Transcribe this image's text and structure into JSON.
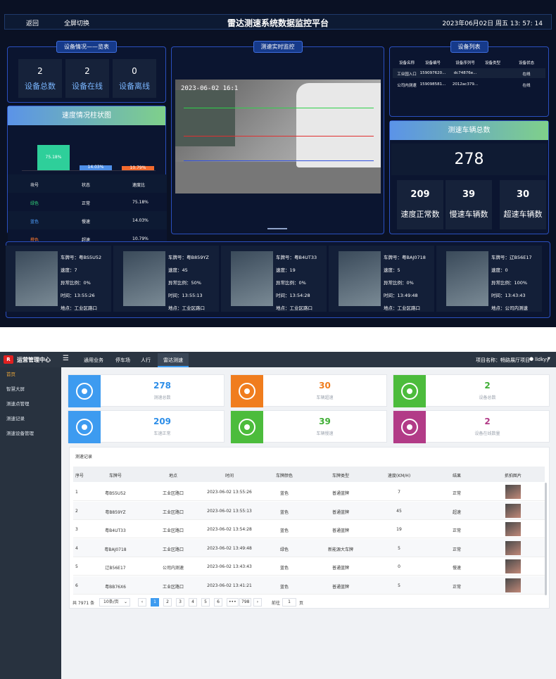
{
  "dashboard": {
    "nav_back": "返回",
    "nav_fullscreen": "全屏切换",
    "title": "雷达测速系统数据监控平台",
    "datetime": "2023年06月02日 周五 13: 57: 14",
    "device_overview": {
      "title": "设备情况——览表",
      "total": {
        "value": "2",
        "label": "设备总数"
      },
      "online": {
        "value": "2",
        "label": "设备在线"
      },
      "offline": {
        "value": "0",
        "label": "设备离线"
      }
    },
    "speed_chart": {
      "title": "速度情况柱状图",
      "bars": [
        {
          "label": "75.18%",
          "value": 75.18,
          "color": "#2ecf9a"
        },
        {
          "label": "14.03%",
          "value": 14.03,
          "color": "#4e8fe8"
        },
        {
          "label": "10.79%",
          "value": 10.79,
          "color": "#f26a2e"
        }
      ],
      "headers": [
        "块号",
        "状态",
        "速度比"
      ],
      "rows": [
        {
          "block": "绿色",
          "status": "正常",
          "ratio": "75.18%",
          "color": "#32d27a"
        },
        {
          "block": "蓝色",
          "status": "慢速",
          "ratio": "14.03%",
          "color": "#4ea0ff"
        },
        {
          "block": "橙色",
          "status": "超速",
          "ratio": "10.79%",
          "color": "#ff7a2e"
        }
      ]
    },
    "live": {
      "title": "测速实时监控",
      "timestamp": "2023-06-02 16:1"
    },
    "device_list": {
      "title": "设备列表",
      "headers": [
        "设备名称",
        "设备编号",
        "设备序列号",
        "设备类型",
        "设备状态"
      ],
      "rows": [
        [
          "工业园入口",
          "159097620...",
          "dc74876e...",
          "",
          "在线"
        ],
        [
          "公司内测速",
          "159098581...",
          "2012ac379...",
          "",
          "在线"
        ]
      ]
    },
    "totals": {
      "title": "测速车辆总数",
      "total": "278",
      "normal": {
        "value": "209",
        "label": "速度正常数"
      },
      "slow": {
        "value": "39",
        "label": "慢速车辆数"
      },
      "fast": {
        "value": "30",
        "label": "超速车辆数"
      }
    },
    "captures": [
      {
        "plate": "车牌号：粤BS5U52",
        "speed": "速度：7",
        "ratio": "异常比例：0%",
        "time": "时间：13:55:26",
        "place": "地点：工业区路口"
      },
      {
        "plate": "车牌号：粤B859YZ",
        "speed": "速度：45",
        "ratio": "异常比例：50%",
        "time": "时间：13:55:13",
        "place": "地点：工业区路口"
      },
      {
        "plate": "车牌号：粤B4UT33",
        "speed": "速度：19",
        "ratio": "异常比例：0%",
        "time": "时间：13:54:28",
        "place": "地点：工业区路口"
      },
      {
        "plate": "车牌号：粤BAJ0718",
        "speed": "速度：5",
        "ratio": "异常比例：0%",
        "time": "时间：13:49:48",
        "place": "地点：工业区路口"
      },
      {
        "plate": "车牌号：辽B56E17",
        "speed": "速度：0",
        "ratio": "异常比例：100%",
        "time": "时间：13:43:43",
        "place": "地点：公司内测速"
      }
    ]
  },
  "admin": {
    "brand": "运营管理中心",
    "tabs": [
      "通用业务",
      "停车场",
      "人行",
      "雷达测速"
    ],
    "project": "项目名称：畅路展厅项目",
    "user": "lldkyy",
    "menu": [
      "首页",
      "智慧大屏",
      "测速点管理",
      "测速记录",
      "测速设备管理"
    ],
    "tiles": [
      {
        "value": "278",
        "label": "测速总数",
        "color": "#3d9bf0",
        "valcolor": "#2d8ee8",
        "icon": "camera-icon"
      },
      {
        "value": "30",
        "label": "车辆超速",
        "color": "#f07d1e",
        "valcolor": "#f07d1e",
        "icon": "speedometer-icon"
      },
      {
        "value": "2",
        "label": "设备总数",
        "color": "#4cbc3c",
        "valcolor": "#3fae35",
        "icon": "cloud-icon"
      },
      {
        "value": "209",
        "label": "车速正常",
        "color": "#3d9bf0",
        "valcolor": "#2d8ee8",
        "icon": "speedometer-icon"
      },
      {
        "value": "39",
        "label": "车辆慢速",
        "color": "#4cbc3c",
        "valcolor": "#3fae35",
        "icon": "speedometer-icon"
      },
      {
        "value": "2",
        "label": "设备在线数量",
        "color": "#b23b87",
        "valcolor": "#b23b87",
        "icon": "device-icon"
      }
    ],
    "records": {
      "title": "测速记录",
      "headers": [
        "序号",
        "车牌号",
        "地点",
        "时间",
        "车牌颜色",
        "车牌类型",
        "速度(KM/H)",
        "结果",
        "抓拍图片"
      ],
      "rows": [
        [
          "1",
          "粤BS5U52",
          "工业区路口",
          "2023-06-02 13:55:26",
          "蓝色",
          "普通蓝牌",
          "7",
          "正常"
        ],
        [
          "2",
          "粤B859YZ",
          "工业区路口",
          "2023-06-02 13:55:13",
          "蓝色",
          "普通蓝牌",
          "45",
          "超速"
        ],
        [
          "3",
          "粤B4UT33",
          "工业区路口",
          "2023-06-02 13:54:28",
          "蓝色",
          "普通蓝牌",
          "19",
          "正常"
        ],
        [
          "4",
          "粤BAJ0718",
          "工业区路口",
          "2023-06-02 13:49:48",
          "绿色",
          "新能源大车牌",
          "5",
          "正常"
        ],
        [
          "5",
          "辽B56E17",
          "公司内测速",
          "2023-06-02 13:43:43",
          "蓝色",
          "普通蓝牌",
          "0",
          "慢速"
        ],
        [
          "6",
          "粤BB76X6",
          "工业区路口",
          "2023-06-02 13:41:21",
          "蓝色",
          "普通蓝牌",
          "5",
          "正常"
        ]
      ]
    },
    "pagination": {
      "total": "共 7971 条",
      "page_size": "10条/页",
      "pages": [
        "1",
        "2",
        "3",
        "4",
        "5",
        "6",
        "•••",
        "798"
      ],
      "goto_label": "前往",
      "goto_value": "1",
      "page_suffix": "页"
    }
  }
}
